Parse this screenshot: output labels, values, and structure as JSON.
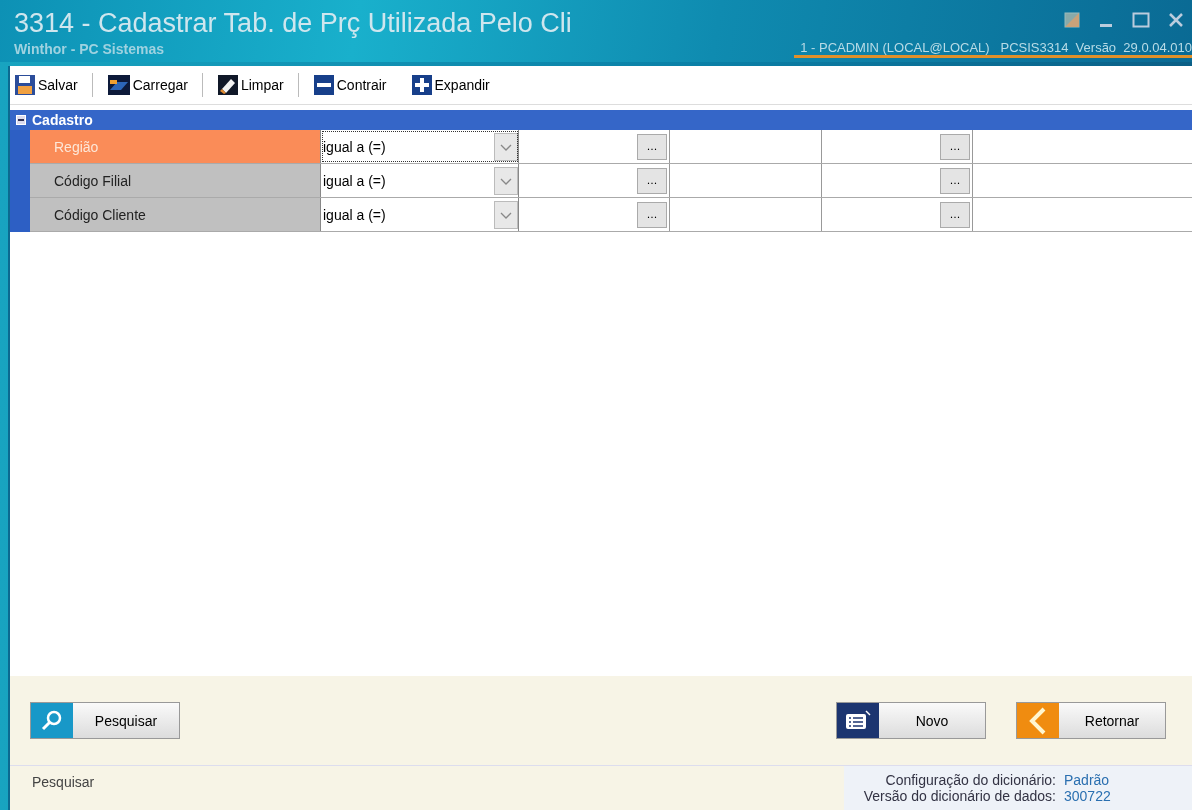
{
  "window": {
    "title": "3314 - Cadastrar Tab. de Prç Utilizada Pelo Cli",
    "subtitle": "Winthor - PC Sistemas",
    "session": "1 - PCADMIN (LOCAL@LOCAL)   PCSIS3314  Versão  29.0.04.010"
  },
  "toolbar": [
    {
      "kind": "save",
      "label": "Salvar"
    },
    {
      "kind": "load",
      "label": "Carregar"
    },
    {
      "kind": "clear",
      "label": "Limpar"
    },
    {
      "kind": "collapse",
      "label": "Contrair"
    },
    {
      "kind": "expand",
      "label": "Expandir"
    }
  ],
  "panel": {
    "title": "Cadastro",
    "expanded": true,
    "rows": [
      {
        "label": "Região",
        "operator": "igual a (=)",
        "selected": true
      },
      {
        "label": "Código Filial",
        "operator": "igual a (=)",
        "selected": false
      },
      {
        "label": "Código Cliente",
        "operator": "igual a (=)",
        "selected": false
      }
    ],
    "lookup_button": "..."
  },
  "buttons": [
    {
      "kind": "search",
      "label": "Pesquisar"
    },
    {
      "kind": "new",
      "label": "Novo"
    },
    {
      "kind": "back",
      "label": "Retornar"
    }
  ],
  "status_bar": {
    "message": "Pesquisar",
    "items": [
      {
        "label": "Configuração do dicionário:",
        "value": "Padrão"
      },
      {
        "label": "Versão do dicionário de dados:",
        "value": "300722"
      }
    ]
  }
}
